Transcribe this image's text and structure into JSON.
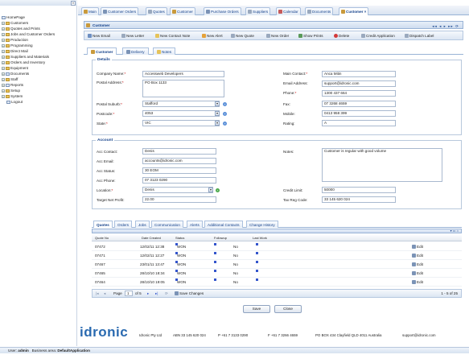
{
  "tree": {
    "items": [
      "HomePage",
      "Customers",
      "Quotes and Prints",
      "Jobs and Customer Orders",
      "Production",
      "Programming",
      "Direct Mail",
      "Suppliers and Materials",
      "Orders and Inventory",
      "Equipment",
      "Documents",
      "Staff",
      "Reports",
      "Setup",
      "System",
      "Logout"
    ]
  },
  "tabs": [
    "Main",
    "Customer Orders",
    "Quotes",
    "Customer",
    "Purchase Orders",
    "Suppliers",
    "Calendar",
    "Documents",
    "Customer"
  ],
  "panel": {
    "title": "Customer",
    "toolbar": [
      "New Email",
      "New Letter",
      "New Contact Note",
      "New Alert",
      "New Quote",
      "New Order",
      "Show Prints",
      "Delete",
      "Credit Application",
      "Dispatch Label"
    ],
    "subtabs": [
      "Customer",
      "Delivery",
      "Notes"
    ]
  },
  "details": {
    "legend": "Details",
    "company_name_label": "Company Name:",
    "company_name": "Accessweb Developers",
    "postal_address_label": "Postal Address:",
    "postal_address": "PO Box 1133",
    "postal_suburb_label": "Postal Suburb:",
    "postal_suburb": "Stafford",
    "postcode_label": "Postcode:",
    "postcode": "4053",
    "state_label": "State:",
    "state": "VIC",
    "main_contact_label": "Main Contact:",
    "main_contact": "Anca Mitin",
    "email_label": "Email Address:",
    "email": "support@idronic.com",
    "phone_label": "Phone:",
    "phone": "1300 437 664",
    "fax_label": "Fax:",
    "fax": "07 3268 4659",
    "mobile_label": "Mobile:",
    "mobile": "0413 958 399",
    "rating_label": "Rating:",
    "rating": "A"
  },
  "account": {
    "legend": "Account",
    "acc_contact_label": "Acc Contact:",
    "acc_contact": "Denis",
    "acc_email_label": "Acc Email:",
    "acc_email": "accounts@idronic.com",
    "acc_status_label": "Acc Status:",
    "acc_status": "30 EOM",
    "acc_phone_label": "Acc Phone:",
    "acc_phone": "07 3123 0290",
    "location_label": "Location:",
    "location": "Denis",
    "target_label": "Target Net Profit:",
    "target": "22.00",
    "notes_label": "Notes:",
    "notes": "Customer is regular with good volume",
    "credit_limit_label": "Credit Limit:",
    "credit_limit": "50000",
    "tax_reg_label": "Tax Reg Code:",
    "tax_reg": "33 145 620 024"
  },
  "grid": {
    "tabs": [
      "Quotes",
      "Orders",
      "Jobs",
      "Communication",
      "Alerts",
      "Additional Contacts",
      "Change History"
    ],
    "headers": [
      "Quote No",
      "Date Created",
      "Status",
      "Followup",
      "Last Work"
    ],
    "rows": [
      {
        "no": "07472",
        "date": "12/02/11 12:38",
        "status": "WON",
        "followup": "No",
        "edit": "Edit"
      },
      {
        "no": "07471",
        "date": "12/02/11 12:27",
        "status": "WON",
        "followup": "No",
        "edit": "Edit"
      },
      {
        "no": "07467",
        "date": "23/01/11 13:47",
        "status": "WON",
        "followup": "No",
        "edit": "Edit"
      },
      {
        "no": "07465",
        "date": "28/10/10 18:34",
        "status": "WON",
        "followup": "No",
        "edit": "Edit"
      },
      {
        "no": "07464",
        "date": "28/10/10 19:05",
        "status": "WON",
        "followup": "No",
        "edit": "Edit"
      }
    ],
    "pager": {
      "page_label": "Page",
      "page": "1",
      "of": "of 5",
      "save": "Save Changes",
      "count": "1 - 5 of 25"
    }
  },
  "buttons": {
    "save": "Save",
    "close": "Close"
  },
  "footer": {
    "logo": "idronic",
    "company": "Idronic Pty Ltd",
    "abn": "ABN 33 145 620 024",
    "phone": "P +61 7 3133 0290",
    "fax": "F +61 7 3266 4659",
    "address": "PO BOX 434 Clayfield QLD 4011 Australia",
    "email": "support@idronic.com"
  },
  "status": {
    "user_label": "User:",
    "user": "admin",
    "bp_label": "Business area:",
    "bp": "DefaultApplication"
  }
}
